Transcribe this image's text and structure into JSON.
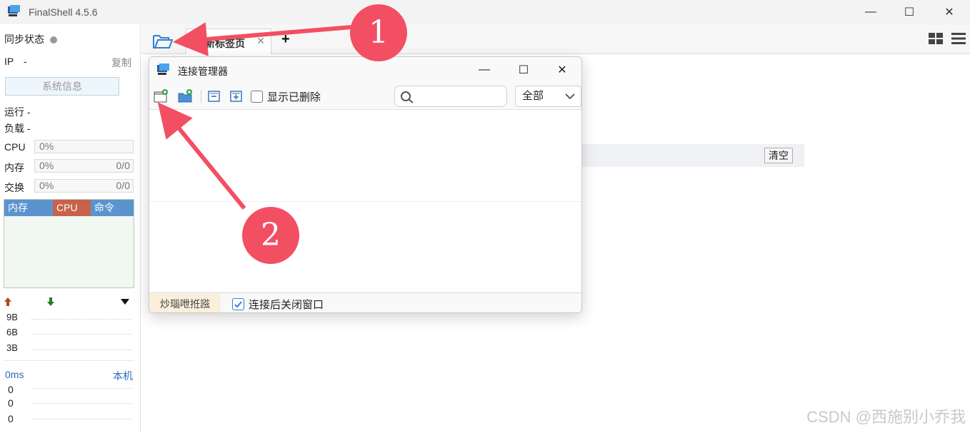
{
  "window": {
    "title": "FinalShell 4.5.6",
    "minimize": "—",
    "maximize": "☐",
    "close": "✕"
  },
  "sidebar": {
    "sync_status": "同步状态",
    "ip_label": "IP",
    "ip_value": "-",
    "copy": "复制",
    "sysinfo": "系统信息",
    "run": "运行 -",
    "load": "负载 -",
    "cpu_label": "CPU",
    "cpu_value": "0%",
    "mem_label": "内存",
    "mem_value": "0%",
    "mem_ratio": "0/0",
    "swap_label": "交换",
    "swap_value": "0%",
    "swap_ratio": "0/0",
    "proc_headers": [
      "内存",
      "CPU",
      "命令"
    ],
    "net_scale": [
      "9B",
      "6B",
      "3B"
    ],
    "ping_label": "0ms",
    "host_label": "本机",
    "ping_values": [
      "0",
      "0",
      "0"
    ]
  },
  "tabs": {
    "new_tab_label": "新标签页",
    "close_glyph": "✕",
    "add_glyph": "+"
  },
  "main": {
    "clear_button": "清空"
  },
  "dialog": {
    "title": "连接管理器",
    "minimize": "—",
    "maximize": "☐",
    "close": "✕",
    "show_deleted": "显示已删除",
    "search_placeholder": "",
    "filter_selected": "全部",
    "footer_tab": "炒瑙呭拰誸",
    "close_after_connect": "连接后关闭窗口"
  },
  "annotations": {
    "badge_1": "1",
    "badge_2": "2",
    "color": "#f24f63"
  },
  "watermark": "CSDN @西施别小乔我",
  "colors": {
    "proc_mem": "#5b93cf",
    "proc_cpu": "#c8624a",
    "proc_cmd": "#5b93cf",
    "accent_blue": "#3a7bd5"
  }
}
